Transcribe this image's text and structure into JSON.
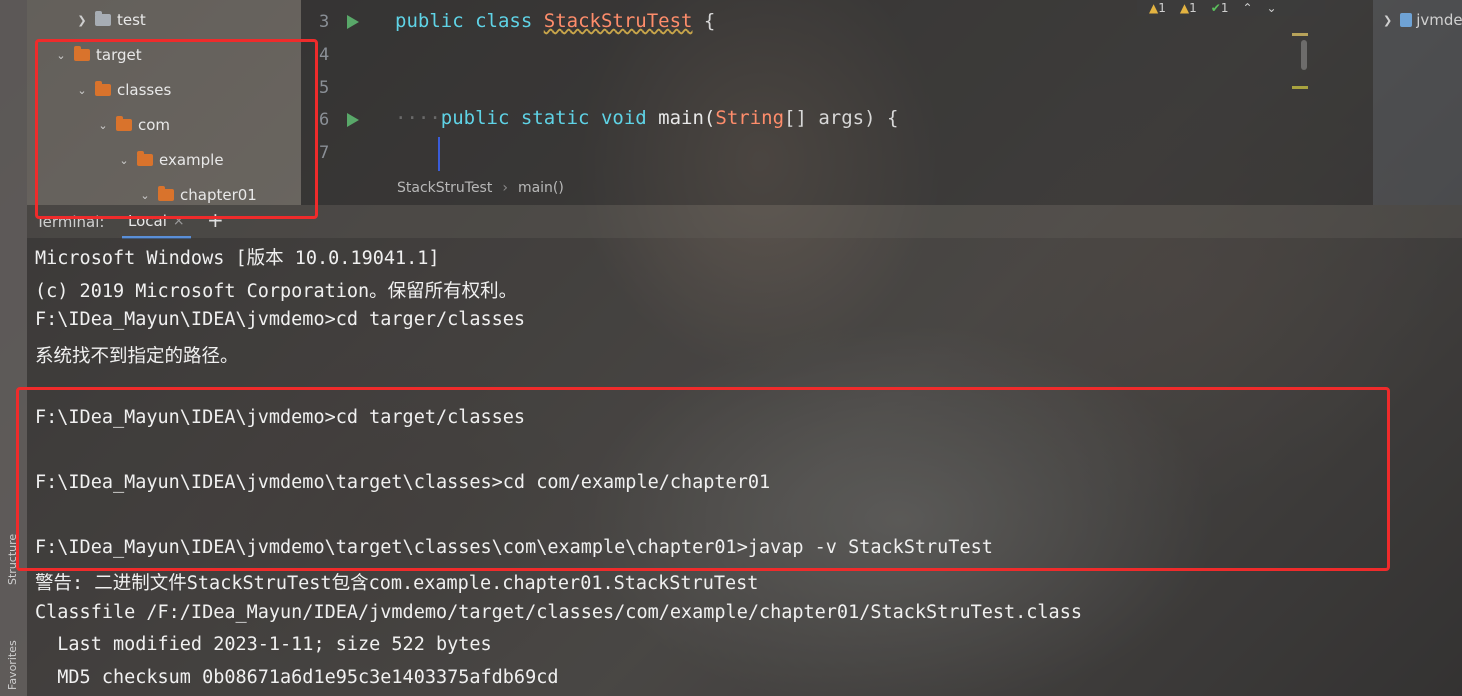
{
  "project_tree": [
    {
      "label": "test",
      "expanded": false,
      "folder_color": "grey"
    },
    {
      "label": "target",
      "expanded": true,
      "folder_color": "orange"
    },
    {
      "label": "classes",
      "expanded": true,
      "folder_color": "orange"
    },
    {
      "label": "com",
      "expanded": true,
      "folder_color": "orange"
    },
    {
      "label": "example",
      "expanded": true,
      "folder_color": "orange"
    },
    {
      "label": "chapter01",
      "expanded": true,
      "folder_color": "orange"
    }
  ],
  "editor": {
    "line_numbers": [
      "3",
      "4",
      "5",
      "6",
      "7"
    ],
    "line3": {
      "kw1": "public",
      "kw2": "class",
      "class_name": "StackStruTest",
      "brace": "{"
    },
    "line6": {
      "dots": "····",
      "kw1": "public",
      "kw2": "static",
      "kw3": "void",
      "method": "main(",
      "type": "String",
      "rest": "[] args) {"
    },
    "breadcrumb": {
      "class": "StackStruTest",
      "separator": "›",
      "method": "main()"
    },
    "inspection": {
      "warnings1": "1",
      "warnings2": "1",
      "ok": "1"
    }
  },
  "right_panel": {
    "label": "jvmde"
  },
  "side_tabs": {
    "structure": "Structure",
    "favorites": "Favorites"
  },
  "terminal": {
    "title": "Terminal:",
    "tab_label": "Local",
    "close_glyph": "×",
    "new_tab_glyph": "+",
    "lines": [
      "Microsoft Windows [版本 10.0.19041.1]",
      "(c) 2019 Microsoft Corporation。保留所有权利。",
      "F:\\IDea_Mayun\\IDEA\\jvmdemo>cd targer/classes",
      "系统找不到指定的路径。",
      "",
      "F:\\IDea_Mayun\\IDEA\\jvmdemo>cd target/classes",
      "",
      "F:\\IDea_Mayun\\IDEA\\jvmdemo\\target\\classes>cd com/example/chapter01",
      "",
      "F:\\IDea_Mayun\\IDEA\\jvmdemo\\target\\classes\\com\\example\\chapter01>javap -v StackStruTest",
      "警告: 二进制文件StackStruTest包含com.example.chapter01.StackStruTest",
      "Classfile /F:/IDea_Mayun/IDEA/jvmdemo/target/classes/com/example/chapter01/StackStruTest.class",
      "  Last modified 2023-1-11; size 522 bytes",
      "  MD5 checksum 0b08671a6d1e95c3e1403375afdb69cd"
    ]
  },
  "colors": {
    "highlight_box": "#ef2b2b",
    "keyword": "#5fd3e6",
    "type": "#ff8d6b",
    "folder": "#d9732c"
  }
}
